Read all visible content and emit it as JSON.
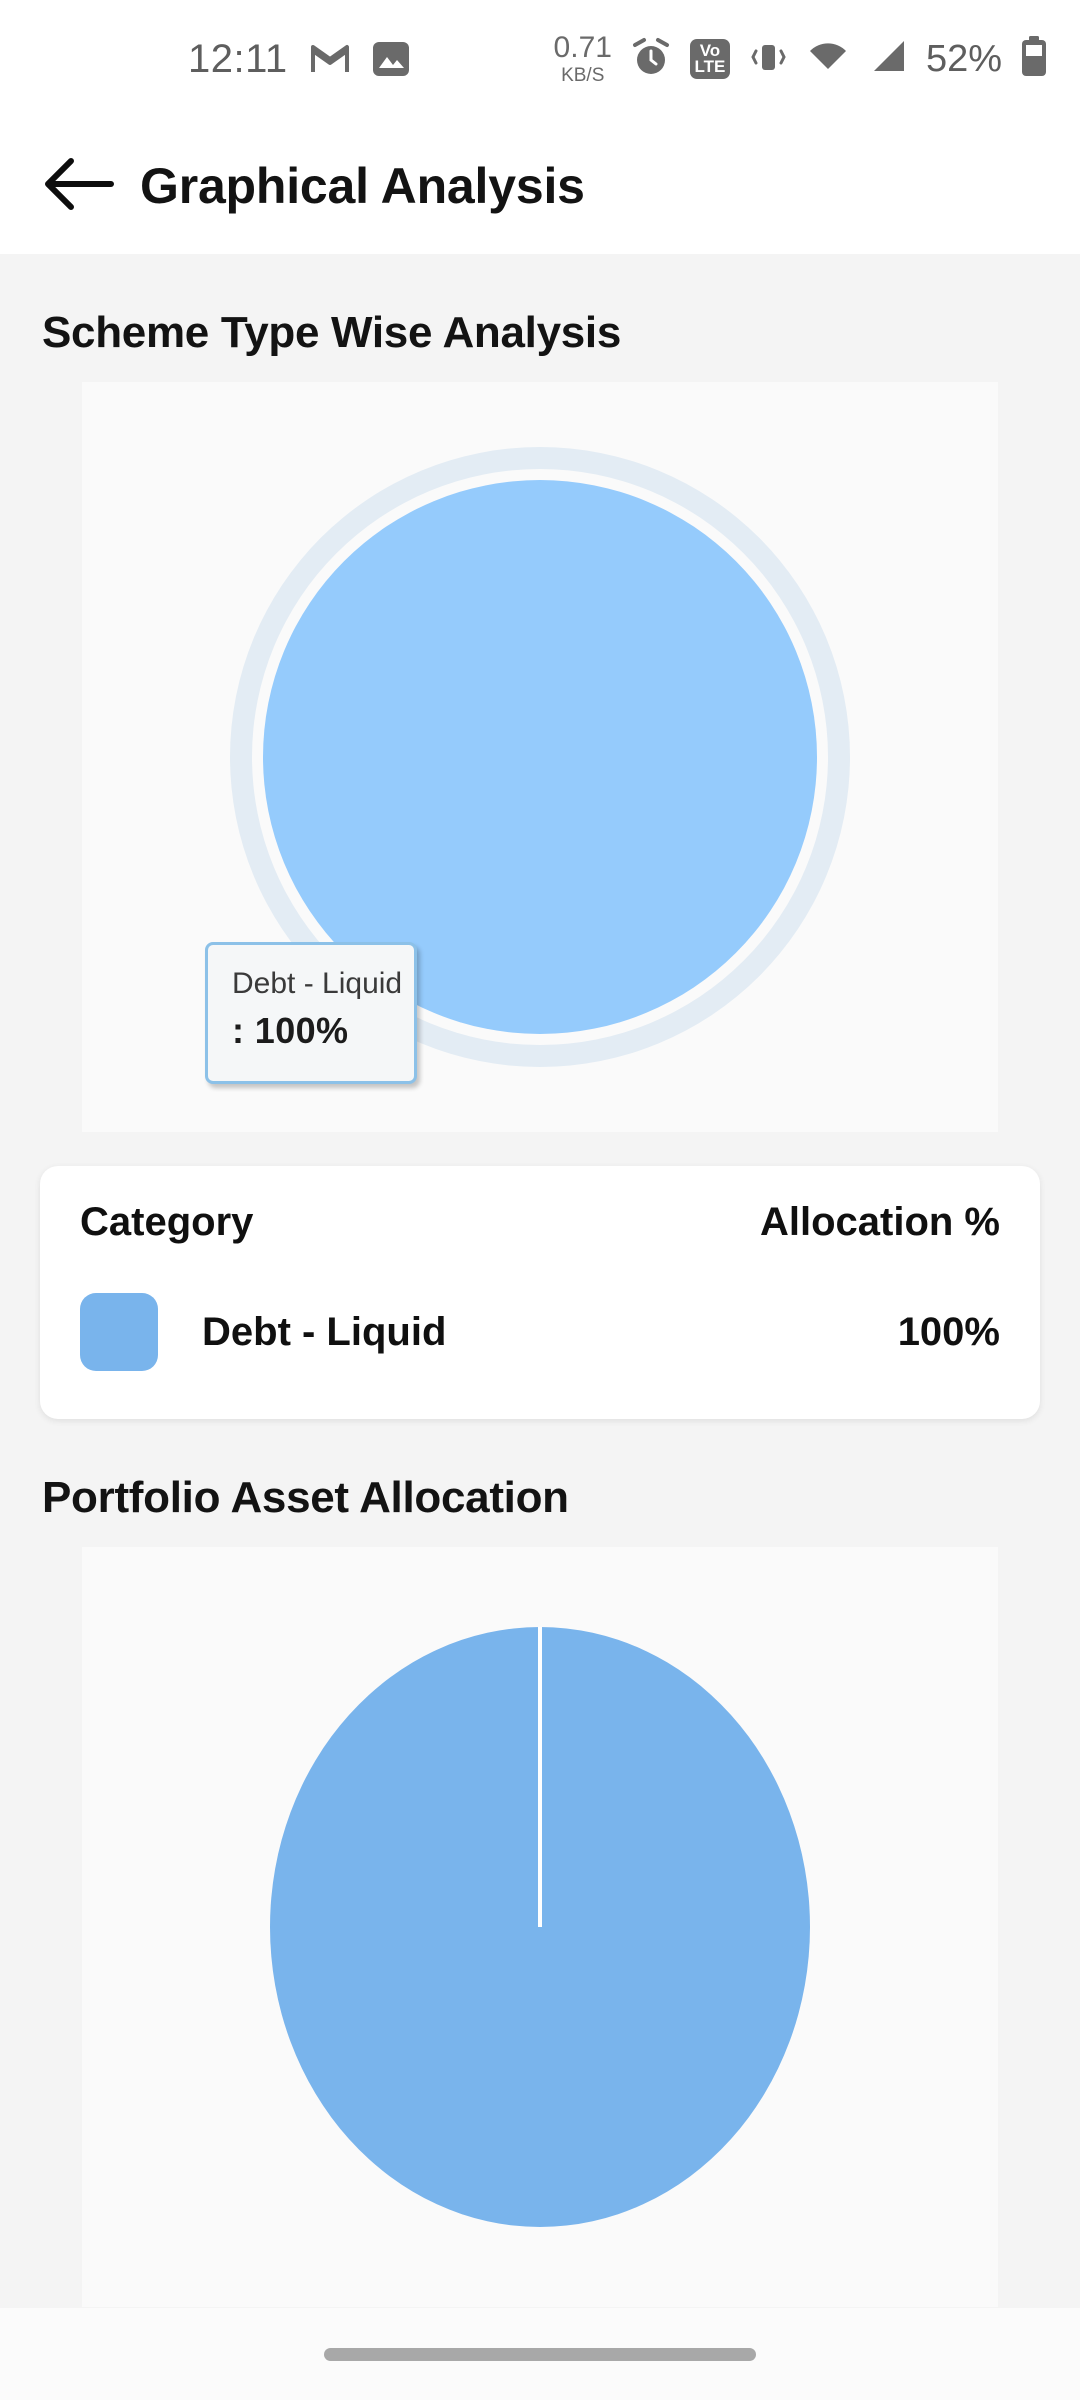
{
  "statusbar": {
    "time": "12:11",
    "gmail_icon": "gmail-icon",
    "photo_icon": "photo-icon",
    "network_speed_value": "0.71",
    "network_speed_unit": "KB/S",
    "alarm_icon": "alarm-clock-icon",
    "volte_line1": "Vo",
    "volte_line2": "LTE",
    "vibrate_icon": "vibrate-icon",
    "wifi_icon": "wifi-icon",
    "signal_icon": "cellular-signal-icon",
    "battery_percent": "52%",
    "battery_icon": "battery-icon"
  },
  "appbar": {
    "back_icon": "back-arrow-icon",
    "title": "Graphical Analysis"
  },
  "sections": {
    "scheme_title": "Scheme Type Wise Analysis",
    "portfolio_title": "Portfolio Asset Allocation"
  },
  "tooltip": {
    "label": "Debt - Liquid",
    "value": ": 100%"
  },
  "legend": {
    "header_category": "Category",
    "header_allocation": "Allocation %",
    "rows": [
      {
        "swatch_color": "#79b4ec",
        "label": "Debt - Liquid",
        "value": "100%"
      }
    ]
  },
  "colors": {
    "pie_blue": "#95cbfc",
    "pie_blue_2": "#79b4ec",
    "halo": "#e3ecf4",
    "panel_bg": "#fafafa",
    "page_bg": "#f4f4f4",
    "tooltip_border": "#8cc1e8"
  },
  "navbar": {
    "home_indicator": "home-indicator"
  },
  "chart_data": [
    {
      "type": "pie",
      "title": "Scheme Type Wise Analysis",
      "categories": [
        "Debt - Liquid"
      ],
      "values": [
        100
      ],
      "value_unit": "%",
      "colors": [
        "#95cbfc"
      ],
      "legend": "table-below",
      "selected_slice": "Debt - Liquid",
      "tooltip_text": "Debt - Liquid : 100%",
      "notes": "Single slice occupying full circle, highlighted with outer halo ring"
    },
    {
      "type": "pie",
      "title": "Portfolio Asset Allocation",
      "categories": [
        "Debt - Liquid"
      ],
      "values": [
        100
      ],
      "value_unit": "%",
      "colors": [
        "#79b4ec"
      ],
      "legend": "none",
      "notes": "Single slice occupying full circle, white radial divider at 12 o'clock"
    }
  ]
}
